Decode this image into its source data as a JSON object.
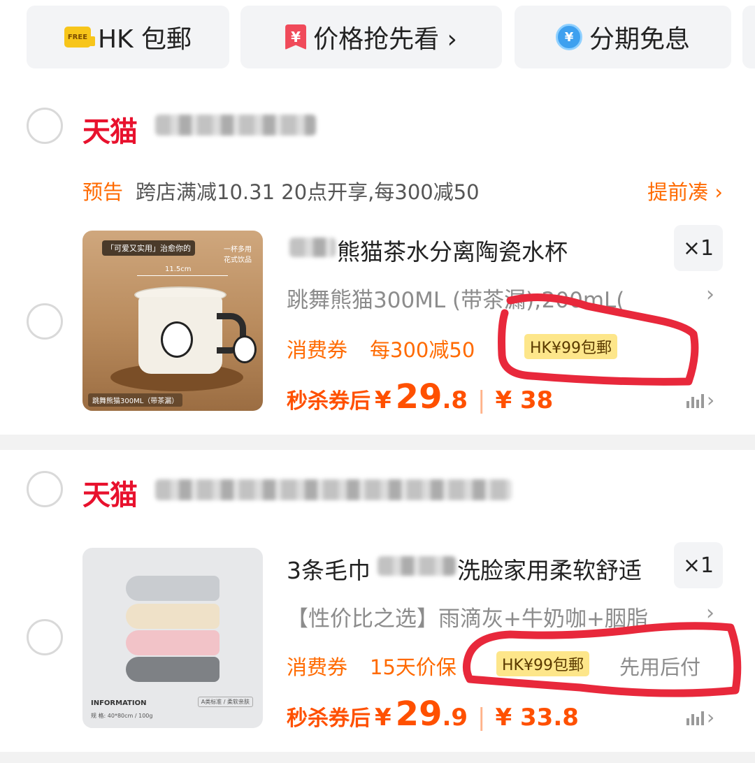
{
  "top_pills": [
    {
      "icon": "free-shipping-truck-icon",
      "label": "HK 包郵"
    },
    {
      "icon": "price-bookmark-icon",
      "label": "价格抢先看 ›"
    },
    {
      "icon": "installment-coin-icon",
      "label": "分期免息"
    }
  ],
  "shops": [
    {
      "platform": "天猫",
      "notice": {
        "tag": "预告",
        "message": "跨店满减10.31 20点开享,每300减50",
        "link": "提前凑 ›"
      },
      "item": {
        "title": "熊猫茶水分离陶瓷水杯",
        "quantity": "×1",
        "sku": "跳舞熊猫300ML (带茶漏);200mL(",
        "coupon_label": "消费券",
        "coupon_text": "每300减50",
        "shipping_badge": "HK¥99包郵",
        "price_label": "秒杀券后",
        "currency": "¥",
        "price_int": "29",
        "price_dec": ".8",
        "original_price": "¥ 38",
        "image_text": {
          "top": "「可爱又实用」治愈你的",
          "side": "一杯多用 花式饮品",
          "bottom": "跳舞熊猫300ML（带茶漏）",
          "dim": "11.5cm"
        }
      }
    },
    {
      "platform": "天猫",
      "item": {
        "title_prefix": "3条毛巾",
        "title_suffix": "洗脸家用柔软舒适",
        "quantity": "×1",
        "sku": "【性价比之选】雨滴灰+牛奶咖+胭脂",
        "coupon_label": "消费券",
        "coupon_text": "15天价保",
        "shipping_badge": "HK¥99包郵",
        "pay_later": "先用后付",
        "price_label": "秒杀券后",
        "currency": "¥",
        "price_int": "29",
        "price_dec": ".9",
        "original_price": "¥ 33.8",
        "image_text": {
          "info": "INFORMATION",
          "spec": "规 格: 40*80cm / 100g",
          "tag": "A类标准 / 柔软亲肤"
        }
      }
    }
  ],
  "chevron": "›",
  "colors": {
    "accent": "#ff5000",
    "tmall_red": "#e8112d",
    "badge_bg": "#fde68a",
    "annotation_red": "#e8283b"
  }
}
